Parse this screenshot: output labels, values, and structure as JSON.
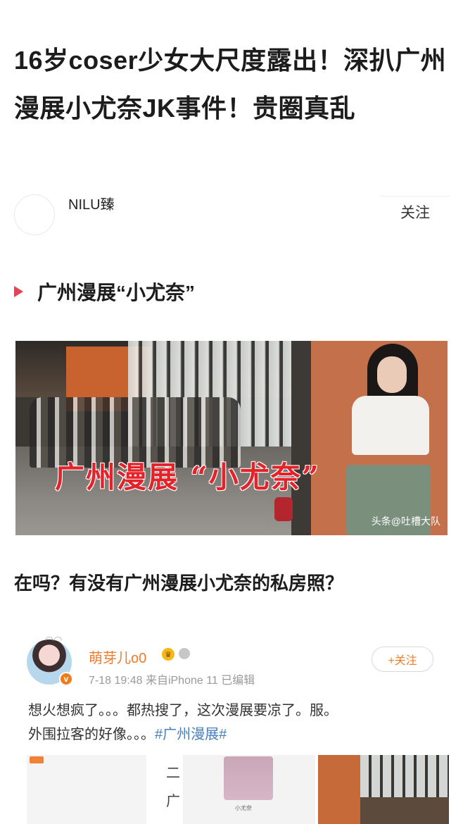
{
  "article": {
    "title": "16岁coser少女大尺度露出！深扒广州漫展小尤奈JK事件！贵圈真乱"
  },
  "author": {
    "name": "NILU臻",
    "follow_label": "关注"
  },
  "section": {
    "heading": "广州漫展“小尤奈”"
  },
  "photo": {
    "caption": "广州漫展  “小尤奈”",
    "watermark": "头条@吐槽大队"
  },
  "question": "在吗？有没有广州漫展小尤奈的私房照？",
  "weibo_post": {
    "user_name": "萌芽儿o0",
    "meta": "7-18 19:48  来自iPhone 11  已编辑",
    "follow_label": "+关注",
    "text_line1": "想火想疯了。。。都热搜了，这次漫展要凉了。服。",
    "text_line2_prefix": "外围拉客的好像。。。",
    "hashtag": "#广州漫展#",
    "badge_letter": "v",
    "thumb_text": "二\n广",
    "thumb_caption": "小尤奈"
  },
  "colors": {
    "accent_red": "#e0455a",
    "weibo_orange": "#f47a2b",
    "link_blue": "#4a7fbf"
  }
}
